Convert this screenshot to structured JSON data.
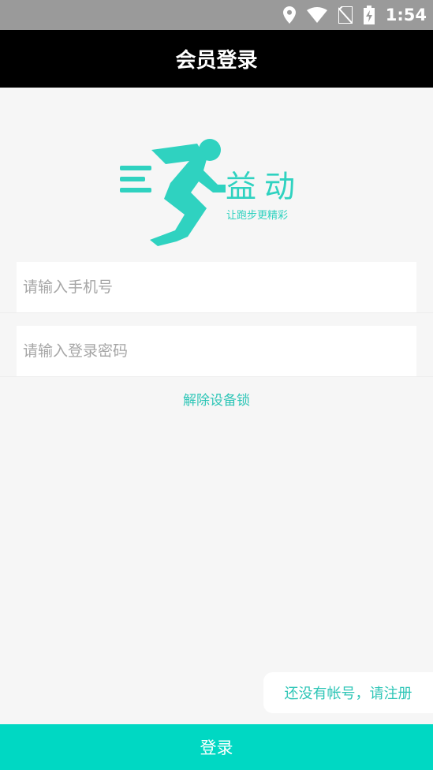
{
  "status_bar": {
    "time": "1:54",
    "icons": [
      "location-icon",
      "wifi-icon",
      "no-sim-icon",
      "battery-charging-icon"
    ]
  },
  "header": {
    "title": "会员登录"
  },
  "logo": {
    "brand": "益动",
    "slogan": "让跑步更精彩",
    "color": "#2fd2c0"
  },
  "form": {
    "phone_placeholder": "请输入手机号",
    "phone_value": "",
    "password_placeholder": "请输入登录密码",
    "password_value": ""
  },
  "links": {
    "unlock_device": "解除设备锁",
    "register": "还没有帐号，请注册"
  },
  "actions": {
    "login_label": "登录"
  },
  "colors": {
    "accent": "#00d8c3",
    "header_bg": "#000000",
    "status_bg": "#9a9a9a",
    "page_bg": "#f6f6f6"
  }
}
